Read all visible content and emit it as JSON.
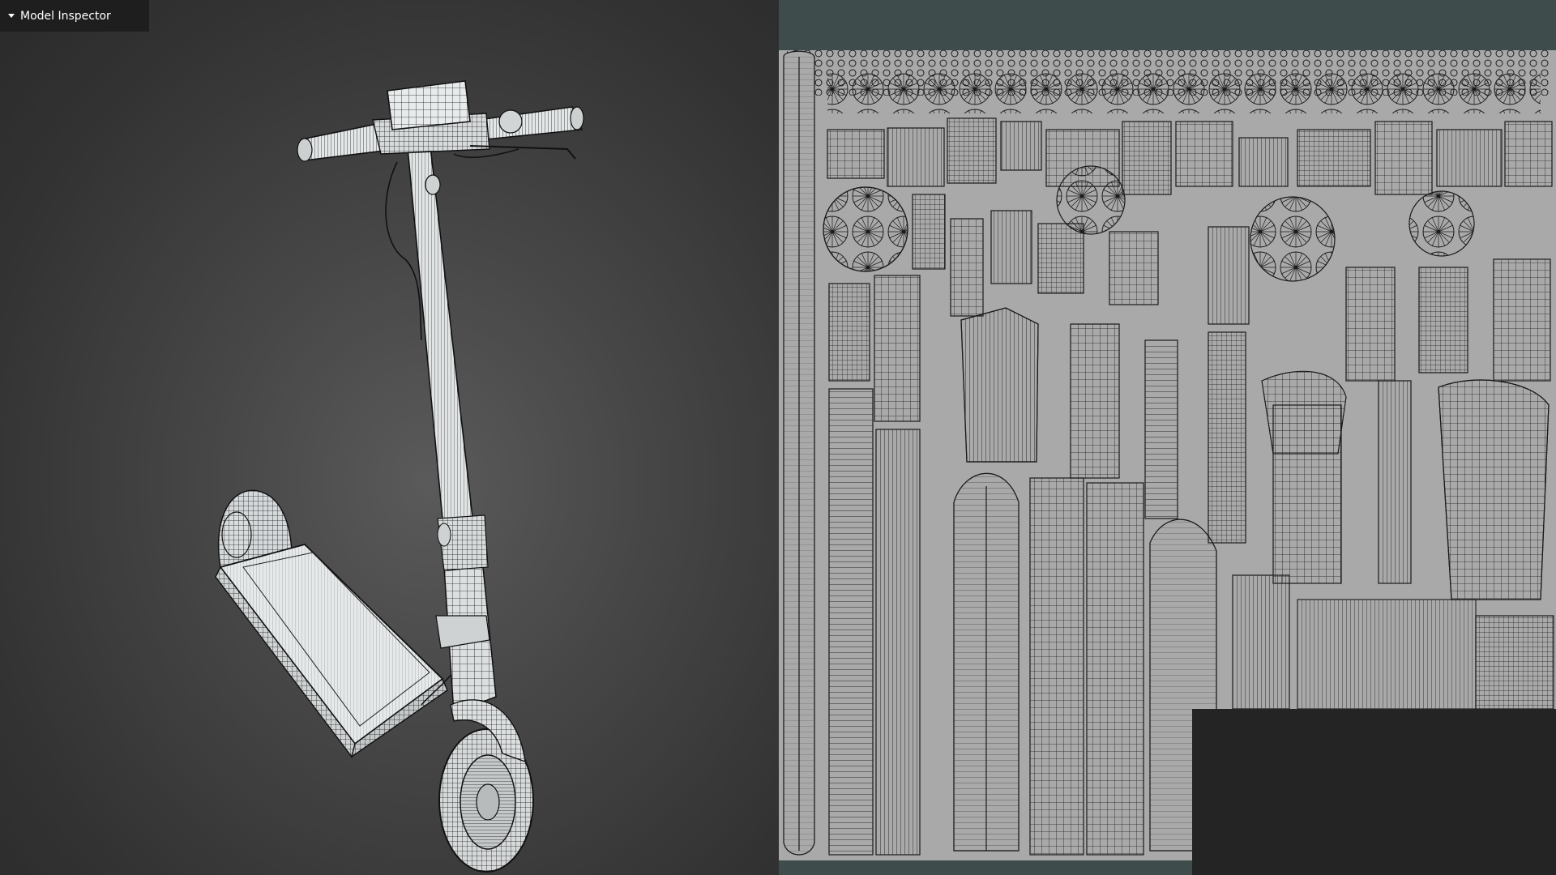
{
  "inspector": {
    "title": "Model Inspector",
    "toggle_icon": "triangle-down-icon"
  },
  "viewport": {
    "mode": "wireframe",
    "object": "electric-scooter"
  },
  "uv_editor": {
    "background_color": "#3f4c4c",
    "sheet_color": "#a9a9a9",
    "wire_color": "#1a1a1a"
  },
  "colors": {
    "viewport_center": "#5a5a5a",
    "viewport_edge": "#2a2a2a",
    "tab_bg": "#1e1e1e"
  }
}
